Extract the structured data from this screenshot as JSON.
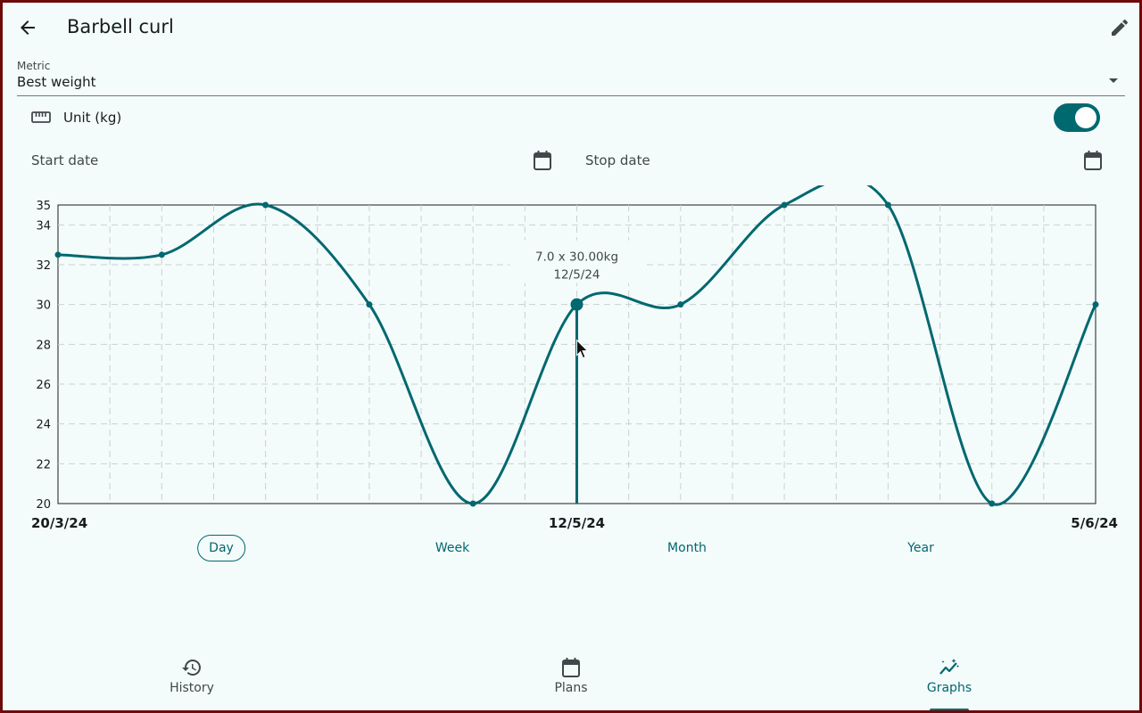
{
  "header": {
    "title": "Barbell curl",
    "back_icon": "arrow-back-icon",
    "edit_icon": "pencil-icon"
  },
  "metric": {
    "label": "Metric",
    "value": "Best weight"
  },
  "unit": {
    "label": "Unit (kg)",
    "icon": "ruler-icon",
    "enabled": true
  },
  "dates": {
    "start_label": "Start date",
    "stop_label": "Stop date",
    "icon": "calendar-icon"
  },
  "chart_data": {
    "type": "line",
    "x": [
      "20/3/24",
      "",
      "",
      "",
      "",
      "",
      "12/5/24",
      "",
      "",
      "",
      "",
      "",
      "5/6/24"
    ],
    "series": [
      {
        "values": [
          32.5,
          32.5,
          35,
          30,
          20,
          30,
          30,
          35,
          35,
          20,
          30
        ]
      }
    ],
    "point_index_layout": [
      0,
      2,
      4,
      6,
      8,
      10,
      12,
      14,
      16,
      18,
      20
    ],
    "ylim": [
      20,
      35
    ],
    "yticks": [
      20,
      22,
      24,
      26,
      28,
      30,
      32,
      34,
      35
    ],
    "x_tick_labels": [
      "20/3/24",
      "12/5/24",
      "5/6/24"
    ],
    "grid": true,
    "line_color": "#00686f",
    "tooltip": {
      "line1": "7.0 x 30.00kg",
      "line2": "12/5/24",
      "point_index": 5
    }
  },
  "range_tabs": [
    {
      "label": "Day",
      "selected": true
    },
    {
      "label": "Week",
      "selected": false
    },
    {
      "label": "Month",
      "selected": false
    },
    {
      "label": "Year",
      "selected": false
    }
  ],
  "nav": [
    {
      "label": "History",
      "icon": "history-icon",
      "active": false
    },
    {
      "label": "Plans",
      "icon": "calendar-icon",
      "active": false
    },
    {
      "label": "Graphs",
      "icon": "graph-icon",
      "active": true
    }
  ],
  "colors": {
    "accent": "#00686f",
    "background": "#f4fbfb",
    "frame": "#6e0a0a"
  }
}
